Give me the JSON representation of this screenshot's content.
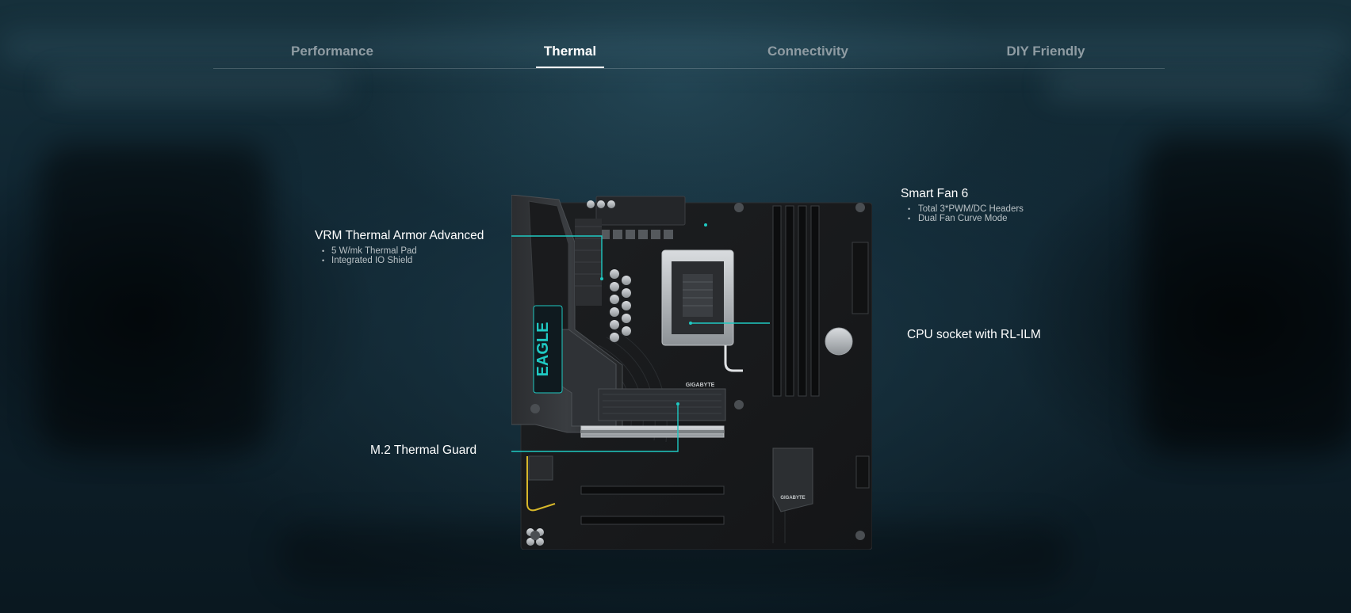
{
  "tabs": [
    {
      "label": "Performance",
      "active": false
    },
    {
      "label": "Thermal",
      "active": true
    },
    {
      "label": "Connectivity",
      "active": false
    },
    {
      "label": "DIY Friendly",
      "active": false
    }
  ],
  "callouts": {
    "vrm": {
      "title": "VRM Thermal Armor Advanced",
      "bullets": [
        "5 W/mk Thermal Pad",
        "Integrated IO Shield"
      ]
    },
    "m2": {
      "title": "M.2 Thermal Guard"
    },
    "fan": {
      "title": "Smart Fan 6",
      "bullets": [
        "Total 3*PWM/DC Headers",
        "Dual Fan Curve Mode"
      ]
    },
    "cpu": {
      "title": "CPU socket with RL-ILM"
    }
  },
  "board": {
    "brand": "GIGABYTE",
    "heatsink_text": "EAGLE"
  },
  "colors": {
    "accent_line": "#1fc9c2",
    "tab_active": "#ffffff",
    "tab_inactive": "#8f9ca3"
  }
}
